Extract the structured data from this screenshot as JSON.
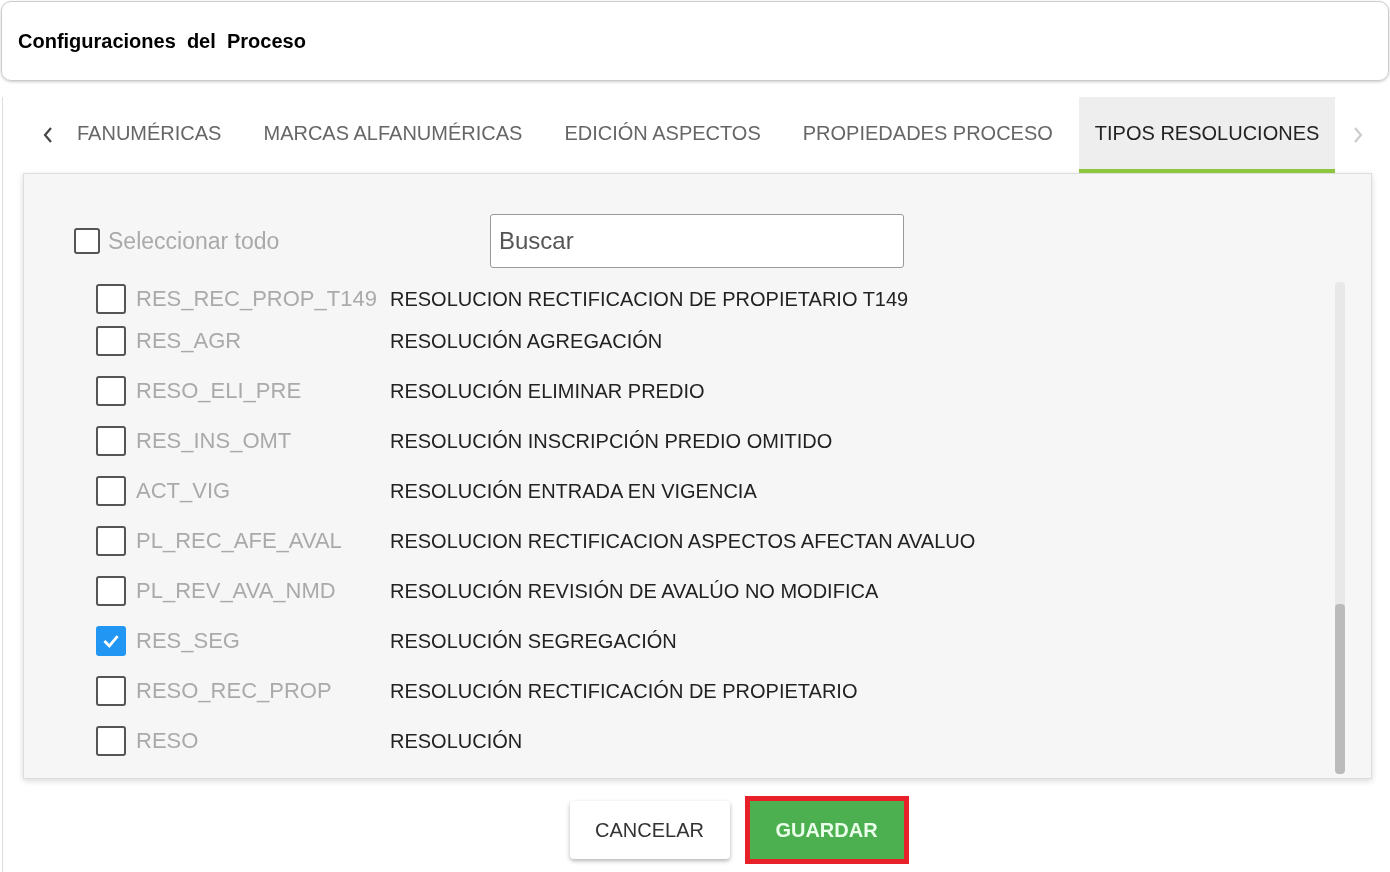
{
  "header": {
    "title": "Configuraciones  del  Proceso"
  },
  "tabs": [
    {
      "label": "FANUMÉRICAS",
      "selected": false
    },
    {
      "label": "MARCAS ALFANUMÉRICAS",
      "selected": false
    },
    {
      "label": "EDICIÓN ASPECTOS",
      "selected": false
    },
    {
      "label": "PROPIEDADES PROCESO",
      "selected": false
    },
    {
      "label": "TIPOS RESOLUCIONES",
      "selected": true
    }
  ],
  "select_all": {
    "label": "Seleccionar todo",
    "checked": false
  },
  "search": {
    "placeholder": "Buscar"
  },
  "rows": [
    {
      "code": "RES_REC_PROP_T149",
      "name": "RESOLUCION RECTIFICACION DE PROPIETARIO T149",
      "checked": false
    },
    {
      "code": "RES_AGR",
      "name": "RESOLUCIÓN AGREGACIÓN",
      "checked": false
    },
    {
      "code": "RESO_ELI_PRE",
      "name": "RESOLUCIÓN ELIMINAR PREDIO",
      "checked": false
    },
    {
      "code": "RES_INS_OMT",
      "name": "RESOLUCIÓN INSCRIPCIÓN PREDIO OMITIDO",
      "checked": false
    },
    {
      "code": "ACT_VIG",
      "name": "RESOLUCIÓN ENTRADA EN VIGENCIA",
      "checked": false
    },
    {
      "code": "PL_REC_AFE_AVAL",
      "name": "RESOLUCION RECTIFICACION ASPECTOS AFECTAN AVALUO",
      "checked": false
    },
    {
      "code": "PL_REV_AVA_NMD",
      "name": "RESOLUCIÓN REVISIÓN DE AVALÚO NO MODIFICA",
      "checked": false
    },
    {
      "code": "RES_SEG",
      "name": "RESOLUCIÓN SEGREGACIÓN",
      "checked": true
    },
    {
      "code": "RESO_REC_PROP",
      "name": "RESOLUCIÓN RECTIFICACIÓN DE PROPIETARIO",
      "checked": false
    },
    {
      "code": "RESO",
      "name": "RESOLUCIÓN",
      "checked": false
    }
  ],
  "buttons": [
    {
      "label": "CANCELAR",
      "kind": "secondary"
    },
    {
      "label": "GUARDAR",
      "kind": "primary",
      "highlighted": true
    }
  ]
}
